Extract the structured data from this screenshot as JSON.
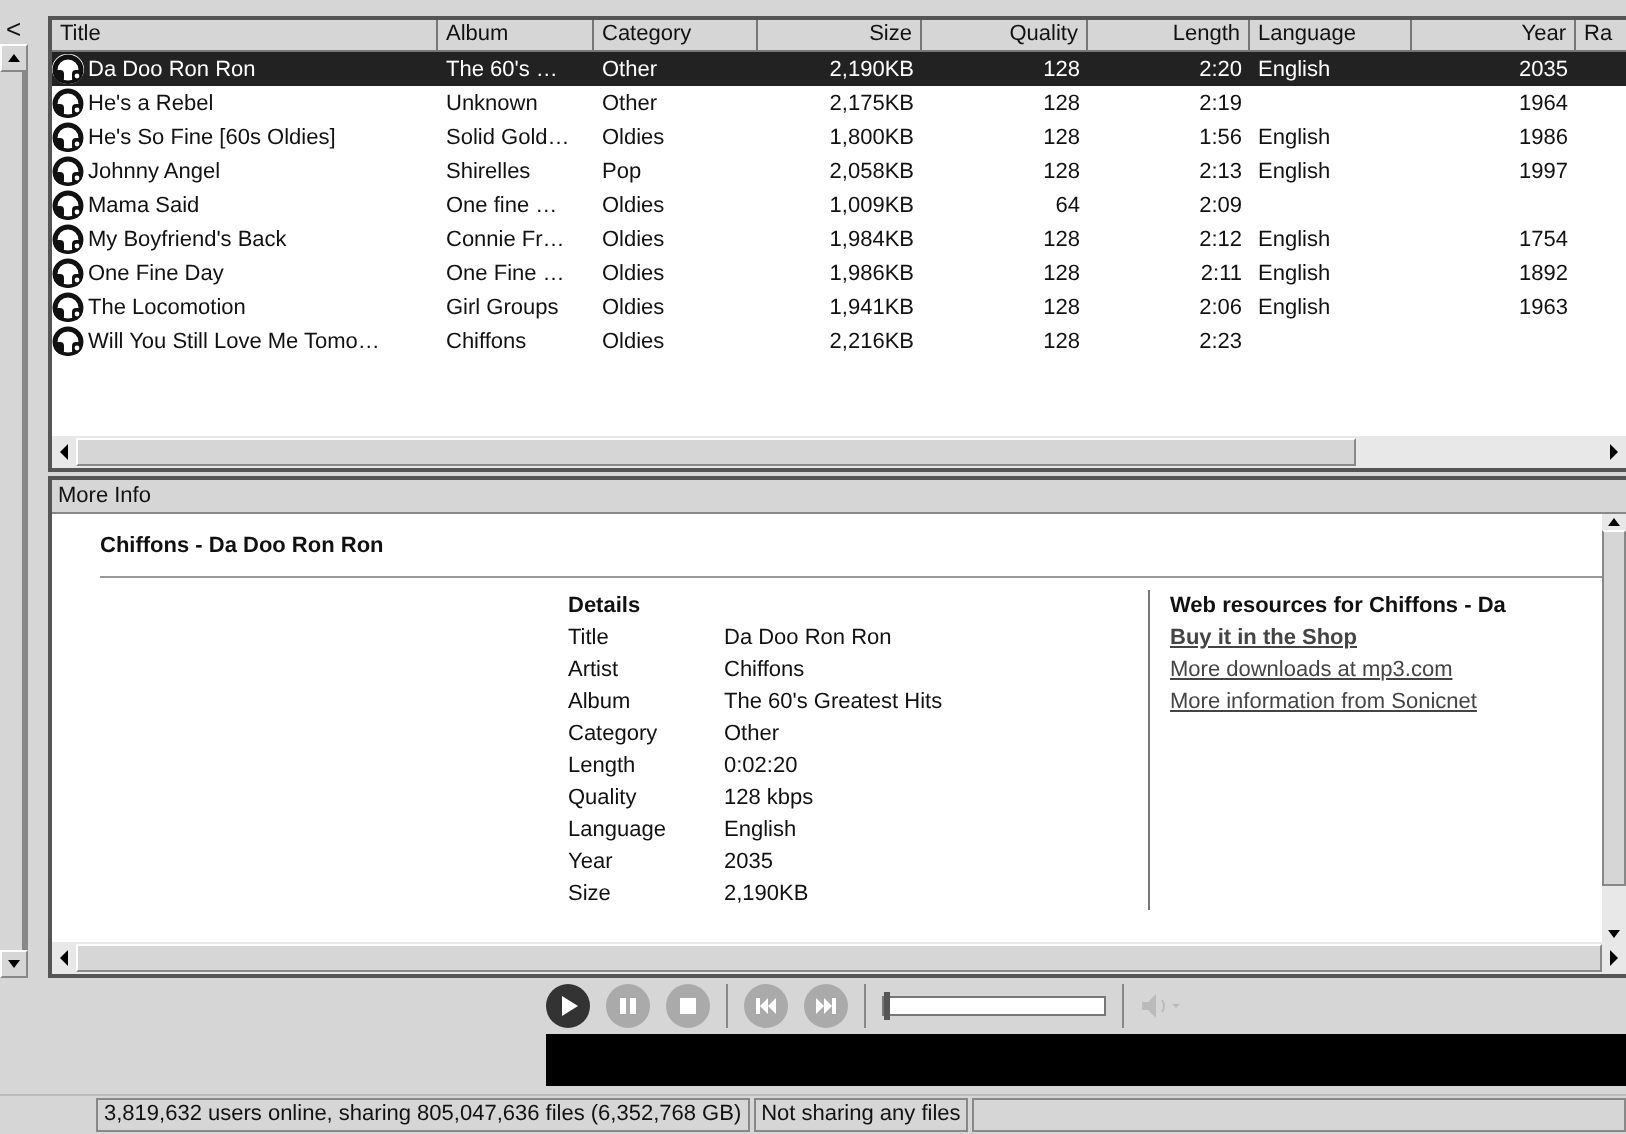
{
  "sidebar": {
    "collapse_glyph": "<"
  },
  "table": {
    "columns": [
      "Title",
      "Album",
      "Category",
      "Size",
      "Quality",
      "Length",
      "Language",
      "Year",
      "Ra"
    ],
    "rows": [
      {
        "selected": true,
        "cells": [
          "Da Doo Ron Ron",
          "The 60's …",
          "Other",
          "2,190KB",
          "128",
          "2:20",
          "English",
          "2035",
          ""
        ]
      },
      {
        "selected": false,
        "cells": [
          "He's a Rebel",
          "Unknown",
          "Other",
          "2,175KB",
          "128",
          "2:19",
          "",
          "1964",
          ""
        ]
      },
      {
        "selected": false,
        "cells": [
          "He's So Fine [60s Oldies]",
          "Solid Gold…",
          "Oldies",
          "1,800KB",
          "128",
          "1:56",
          "English",
          "1986",
          ""
        ]
      },
      {
        "selected": false,
        "cells": [
          "Johnny Angel",
          "Shirelles",
          "Pop",
          "2,058KB",
          "128",
          "2:13",
          "English",
          "1997",
          ""
        ]
      },
      {
        "selected": false,
        "cells": [
          "Mama Said",
          "One fine …",
          "Oldies",
          "1,009KB",
          "64",
          "2:09",
          "",
          "",
          ""
        ]
      },
      {
        "selected": false,
        "cells": [
          "My Boyfriend's Back",
          "Connie Fr…",
          "Oldies",
          "1,984KB",
          "128",
          "2:12",
          "English",
          "1754",
          ""
        ]
      },
      {
        "selected": false,
        "cells": [
          "One Fine Day",
          "One Fine …",
          "Oldies",
          "1,986KB",
          "128",
          "2:11",
          "English",
          "1892",
          ""
        ]
      },
      {
        "selected": false,
        "cells": [
          "The Locomotion",
          "Girl Groups",
          "Oldies",
          "1,941KB",
          "128",
          "2:06",
          "English",
          "1963",
          ""
        ]
      },
      {
        "selected": false,
        "cells": [
          "Will You Still Love Me Tomo…",
          "Chiffons",
          "Oldies",
          "2,216KB",
          "128",
          "2:23",
          "",
          "",
          ""
        ]
      }
    ]
  },
  "more_info": {
    "title": "More Info",
    "heading": "Chiffons - Da Doo Ron Ron",
    "details_title": "Details",
    "details": [
      {
        "label": "Title",
        "value": "Da Doo Ron Ron"
      },
      {
        "label": "Artist",
        "value": "Chiffons"
      },
      {
        "label": "Album",
        "value": "The 60's Greatest Hits"
      },
      {
        "label": "Category",
        "value": "Other"
      },
      {
        "label": "Length",
        "value": "0:02:20"
      },
      {
        "label": "Quality",
        "value": "128 kbps"
      },
      {
        "label": "Language",
        "value": "English"
      },
      {
        "label": "Year",
        "value": "2035"
      },
      {
        "label": "Size",
        "value": "2,190KB"
      }
    ],
    "web_title": "Web resources for Chiffons - Da",
    "links": [
      {
        "label": "Buy it in the Shop",
        "bold": true
      },
      {
        "label": "More downloads at mp3.com",
        "bold": false
      },
      {
        "label": "More information from Sonicnet",
        "bold": false
      }
    ]
  },
  "player": {
    "buttons": [
      {
        "kind": "play",
        "disabled": false
      },
      {
        "kind": "pause",
        "disabled": true
      },
      {
        "kind": "stop",
        "disabled": true
      },
      {
        "kind": "previous",
        "disabled": true
      },
      {
        "kind": "next",
        "disabled": true
      }
    ],
    "seek": {
      "level": 0
    }
  },
  "status_bar": [
    "3,819,632 users online, sharing 805,047,636 files (6,352,768 GB)",
    "Not sharing any files"
  ]
}
